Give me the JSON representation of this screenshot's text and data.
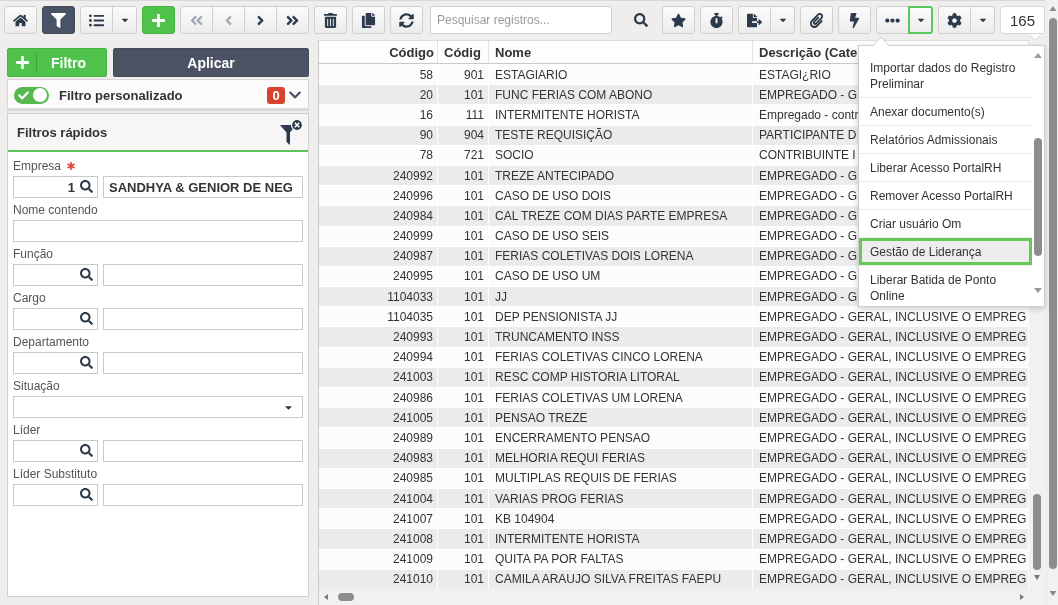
{
  "toolbar": {
    "buttons": [
      {
        "kind": "icon",
        "active": false,
        "disabled": false,
        "focused": false
      },
      {
        "kind": "icon",
        "active": true,
        "disabled": false,
        "focused": false
      },
      {
        "kind": "icon",
        "active": false,
        "disabled": false,
        "focused": false
      },
      {
        "kind": "caret",
        "active": false,
        "disabled": false,
        "focused": false
      },
      {
        "kind": "primary",
        "active": false,
        "disabled": false,
        "focused": false
      },
      {
        "kind": "icon",
        "active": false,
        "disabled": true,
        "focused": false
      },
      {
        "kind": "icon",
        "active": false,
        "disabled": true,
        "focused": false
      },
      {
        "kind": "icon",
        "active": false,
        "disabled": false,
        "focused": false
      },
      {
        "kind": "icon",
        "active": false,
        "disabled": false,
        "focused": false
      },
      {
        "kind": "icon",
        "active": false,
        "disabled": false,
        "focused": false
      },
      {
        "kind": "icon",
        "active": false,
        "disabled": false,
        "focused": false
      },
      {
        "kind": "icon",
        "active": false,
        "disabled": false,
        "focused": false
      },
      {
        "kind": "icon",
        "active": false,
        "disabled": false,
        "focused": false
      },
      {
        "kind": "icon",
        "active": false,
        "disabled": false,
        "focused": false
      },
      {
        "kind": "icon",
        "active": false,
        "disabled": false,
        "focused": false
      },
      {
        "kind": "caret",
        "active": false,
        "disabled": false,
        "focused": false
      },
      {
        "kind": "icon",
        "active": false,
        "disabled": false,
        "focused": false
      },
      {
        "kind": "icon",
        "active": false,
        "disabled": false,
        "focused": false
      },
      {
        "kind": "icon",
        "active": false,
        "disabled": false,
        "focused": false
      },
      {
        "kind": "caret",
        "active": false,
        "disabled": false,
        "focused": true
      },
      {
        "kind": "icon",
        "active": false,
        "disabled": false,
        "focused": false
      },
      {
        "kind": "caret",
        "active": false,
        "disabled": false,
        "focused": false
      }
    ],
    "search": {
      "placeholder": "Pesquisar registros..."
    },
    "record_count": "165"
  },
  "filter_panel": {
    "add_filter_button": "Filtro",
    "apply_button": "Aplicar",
    "custom_filter": {
      "label": "Filtro personalizado",
      "on": true,
      "count": "0"
    },
    "quick_filters": {
      "title": "Filtros rápidos",
      "fields": [
        {
          "label": "Empresa",
          "required": true,
          "kind": "lookup",
          "code": "1",
          "value": "SANDHYA & GENIOR DE NEG"
        },
        {
          "label": "Nome contendo",
          "required": false,
          "kind": "text"
        },
        {
          "label": "Função",
          "required": false,
          "kind": "lookup"
        },
        {
          "label": "Cargo",
          "required": false,
          "kind": "lookup"
        },
        {
          "label": "Departamento",
          "required": false,
          "kind": "lookup"
        },
        {
          "label": "Situação",
          "required": false,
          "kind": "select"
        },
        {
          "label": "Líder",
          "required": false,
          "kind": "lookup"
        },
        {
          "label": "Líder Substituto",
          "required": false,
          "kind": "lookup"
        }
      ]
    }
  },
  "table": {
    "columns": [
      "Código",
      "Códig",
      "Nome",
      "Descrição (Cate"
    ],
    "rows": [
      [
        "58",
        "901",
        "ESTAGIARIO",
        "ESTAGI¿RIO"
      ],
      [
        "20",
        "101",
        "FUNC FERIAS COM ABONO",
        "EMPREGADO - G"
      ],
      [
        "16",
        "111",
        "INTERMITENTE HORISTA",
        "Empregado - contr"
      ],
      [
        "90",
        "904",
        "TESTE REQUISIÇÃO",
        "PARTICIPANTE D"
      ],
      [
        "78",
        "721",
        "SOCIO",
        "CONTRIBUINTE I"
      ],
      [
        "240992",
        "101",
        "TREZE ANTECIPADO",
        "EMPREGADO - G"
      ],
      [
        "240996",
        "101",
        "CASO DE USO DOIS",
        "EMPREGADO - G"
      ],
      [
        "240984",
        "101",
        "CAL TREZE COM DIAS PARTE EMPRESA",
        "EMPREGADO - G"
      ],
      [
        "240999",
        "101",
        "CASO DE USO SEIS",
        "EMPREGADO - G"
      ],
      [
        "240987",
        "101",
        "FERIAS COLETIVAS DOIS LORENA",
        "EMPREGADO - G"
      ],
      [
        "240995",
        "101",
        "CASO DE USO UM",
        "EMPREGADO - G"
      ],
      [
        "1104033",
        "101",
        "JJ",
        "EMPREGADO - G"
      ],
      [
        "1104035",
        "101",
        "DEP PENSIONISTA JJ",
        "EMPREGADO - GERAL, INCLUSIVE O EMPREG"
      ],
      [
        "240993",
        "101",
        "TRUNCAMENTO INSS",
        "EMPREGADO - GERAL, INCLUSIVE O EMPREG"
      ],
      [
        "240994",
        "101",
        "FERIAS COLETIVAS CINCO LORENA",
        "EMPREGADO - GERAL, INCLUSIVE O EMPREG"
      ],
      [
        "241003",
        "101",
        "RESC COMP HISTORIA LITORAL",
        "EMPREGADO - GERAL, INCLUSIVE O EMPREG"
      ],
      [
        "240986",
        "101",
        "FERIAS COLETIVAS UM LORENA",
        "EMPREGADO - GERAL, INCLUSIVE O EMPREG"
      ],
      [
        "241005",
        "101",
        "PENSAO TREZE",
        "EMPREGADO - GERAL, INCLUSIVE O EMPREG"
      ],
      [
        "240989",
        "101",
        "ENCERRAMENTO PENSAO",
        "EMPREGADO - GERAL, INCLUSIVE O EMPREG"
      ],
      [
        "240983",
        "101",
        "MELHORIA REQUI FERIAS",
        "EMPREGADO - GERAL, INCLUSIVE O EMPREG"
      ],
      [
        "240985",
        "101",
        "MULTIPLAS REQUIS DE FERIAS",
        "EMPREGADO - GERAL, INCLUSIVE O EMPREG"
      ],
      [
        "241004",
        "101",
        "VARIAS PROG FERIAS",
        "EMPREGADO - GERAL, INCLUSIVE O EMPREG"
      ],
      [
        "241007",
        "101",
        "KB 104904",
        "EMPREGADO - GERAL, INCLUSIVE O EMPREG"
      ],
      [
        "241008",
        "101",
        "INTERMITENTE HORISTA",
        "EMPREGADO - GERAL, INCLUSIVE O EMPREG"
      ],
      [
        "241009",
        "101",
        "QUITA PA POR FALTAS",
        "EMPREGADO - GERAL, INCLUSIVE O EMPREG"
      ],
      [
        "241010",
        "101",
        "CAMILA ARAUJO SILVA FREITAS FAEPU",
        "EMPREGADO - GERAL, INCLUSIVE O EMPREG"
      ]
    ]
  },
  "actions_menu": {
    "items": [
      {
        "label": "Importar dados do Registro Preliminar",
        "selected": false
      },
      {
        "label": "Anexar documento(s)",
        "selected": false
      },
      {
        "label": "Relatórios Admissionais",
        "selected": false
      },
      {
        "label": "Liberar Acesso PortalRH",
        "selected": false
      },
      {
        "label": "Remover Acesso PortalRH",
        "selected": false
      },
      {
        "label": "Criar usuário Om",
        "selected": false
      },
      {
        "label": "Gestão de Liderança",
        "selected": true
      },
      {
        "label": "Liberar Batida de Ponto Online",
        "selected": false
      }
    ]
  }
}
